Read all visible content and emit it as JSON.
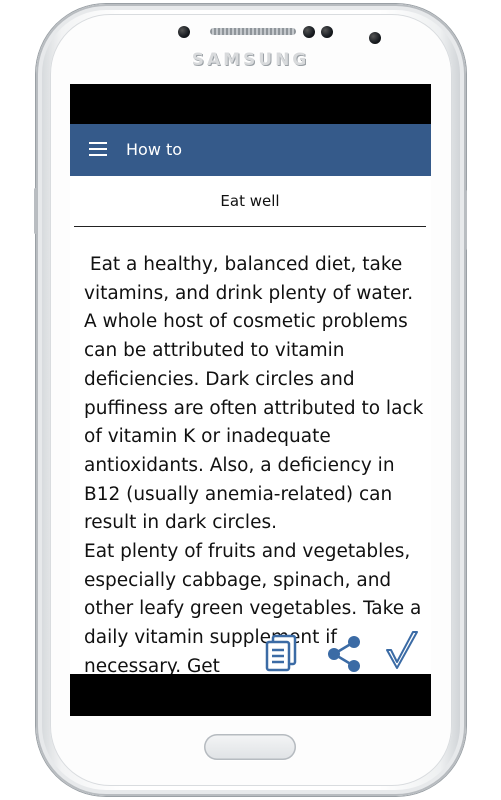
{
  "device": {
    "brand": "SAMSUNG"
  },
  "toolbar": {
    "title": "How to",
    "menu_icon": "hamburger-menu-icon",
    "background_color": "#355a8a"
  },
  "section": {
    "title": "Eat well"
  },
  "article": {
    "paragraph_1": " Eat a healthy, balanced diet, take vitamins, and drink plenty of water. A whole host of cosmetic problems can be attributed to vitamin deficiencies. Dark circles and puffiness are often attributed to lack of vitamin K or inadequate antioxidants. Also, a deficiency in B12 (usually anemia-related) can result in dark circles.",
    "paragraph_2": "Eat plenty of fruits and vegetables, especially cabbage, spinach, and other leafy green vegetables. Take a daily vitamin supplement if necessary. Get"
  },
  "actions": {
    "copy_icon": "document-copy-icon",
    "share_icon": "share-icon",
    "check_icon": "checkmark-icon",
    "icon_color": "#3b6ba5"
  }
}
